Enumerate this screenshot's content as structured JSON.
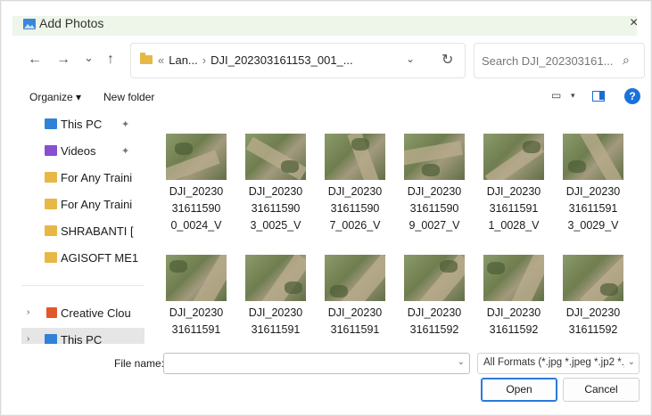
{
  "window": {
    "title": "Add Photos",
    "close_glyph": "×"
  },
  "nav": {
    "back": "←",
    "forward": "→",
    "recent": "⌄",
    "up": "↑"
  },
  "address": {
    "crumb1": "Lan...",
    "crumb2": "DJI_202303161153_001_...",
    "separator": "›",
    "overflow": "«",
    "dropdown": "⌄",
    "refresh": "↻"
  },
  "search": {
    "placeholder": "Search DJI_202303161...",
    "icon": "⌕"
  },
  "commandbar": {
    "organize": "Organize ▾",
    "new_folder": "New folder",
    "view_icon": "▭",
    "view_chev": "▾",
    "help": "?"
  },
  "sidebar": {
    "items": [
      {
        "label": "This PC",
        "icon": "pc-icon",
        "pinned": true
      },
      {
        "label": "Videos",
        "icon": "videos-icon",
        "pinned": true
      },
      {
        "label": "For Any Traini",
        "icon": "folder-icon"
      },
      {
        "label": "For Any Traini",
        "icon": "folder-icon"
      },
      {
        "label": "SHRABANTI [",
        "icon": "folder-icon"
      },
      {
        "label": "AGISOFT ME1",
        "icon": "folder-icon"
      },
      {
        "label": "Creative Clou",
        "icon": "creative-cloud-icon",
        "expander": "›"
      },
      {
        "label": "This PC",
        "icon": "pc-icon",
        "expander": "›",
        "selected": true
      }
    ],
    "pin_glyph": "✦"
  },
  "files": [
    {
      "lines": [
        "DJI_20230",
        "31611590",
        "0_0024_V"
      ]
    },
    {
      "lines": [
        "DJI_20230",
        "31611590",
        "3_0025_V"
      ]
    },
    {
      "lines": [
        "DJI_20230",
        "31611590",
        "7_0026_V"
      ]
    },
    {
      "lines": [
        "DJI_20230",
        "31611590",
        "9_0027_V"
      ]
    },
    {
      "lines": [
        "DJI_20230",
        "31611591",
        "1_0028_V"
      ]
    },
    {
      "lines": [
        "DJI_20230",
        "31611591",
        "3_0029_V"
      ]
    },
    {
      "lines": [
        "DJI_20230",
        "31611591",
        ""
      ]
    },
    {
      "lines": [
        "DJI_20230",
        "31611591",
        ""
      ]
    },
    {
      "lines": [
        "DJI_20230",
        "31611591",
        ""
      ]
    },
    {
      "lines": [
        "DJI_20230",
        "31611592",
        ""
      ]
    },
    {
      "lines": [
        "DJI_20230",
        "31611592",
        ""
      ]
    },
    {
      "lines": [
        "DJI_20230",
        "31611592",
        ""
      ]
    }
  ],
  "bottom": {
    "file_name_label": "File name:",
    "file_name_value": "",
    "file_name_chev": "⌄",
    "filter": "All Formats (*.jpg *.jpeg *.jp2 *.j",
    "filter_chev": "⌄",
    "open": "Open",
    "cancel": "Cancel"
  }
}
